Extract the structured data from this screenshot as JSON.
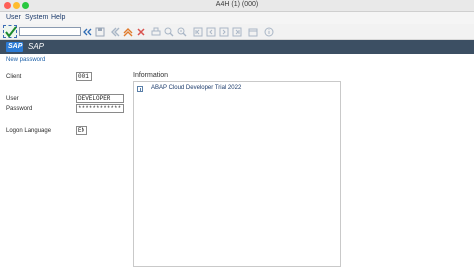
{
  "window": {
    "title": "A4H (1) (000)"
  },
  "menu": {
    "items": [
      "User",
      "System",
      "Help"
    ]
  },
  "toolbar": {
    "command_value": ""
  },
  "header": {
    "logo_text": "SAP",
    "title": "SAP"
  },
  "screen": {
    "subtitle": "New password"
  },
  "form": {
    "client_label": "Client",
    "client_value": "001",
    "user_label": "User",
    "user_value": "DEVELOPER",
    "password_label": "Password",
    "password_value": "************",
    "language_label": "Logon Language",
    "language_value": "EN"
  },
  "info": {
    "heading": "Information",
    "text": "ABAP Cloud Developer Trial 2022"
  },
  "colors": {
    "sap_header": "#3c4f63",
    "accent": "#2b7bd6"
  }
}
